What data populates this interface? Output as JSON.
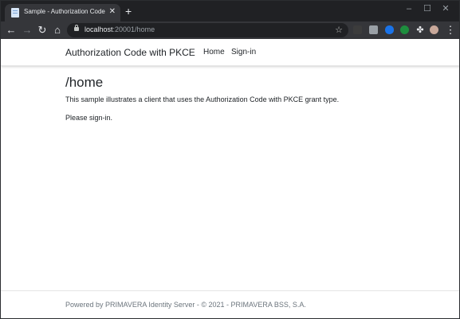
{
  "browser": {
    "tab": {
      "title": "Sample - Authorization Code wit",
      "close": "✕"
    },
    "new_tab": "+",
    "window_controls": {
      "minimize": "–",
      "maximize": "☐",
      "close": "✕"
    },
    "nav": {
      "back": "←",
      "forward": "→",
      "reload": "↻",
      "home": "⌂"
    },
    "address": {
      "host": "localhost",
      "path": ":20001/home"
    },
    "star": "☆",
    "extension_colors": [
      "#3c3c3c",
      "#8ab4f8",
      "#1a73e8",
      "#1e8e3e"
    ],
    "menu": "⋮"
  },
  "site": {
    "brand": "Authorization Code with PKCE",
    "nav": {
      "home": "Home",
      "signin": "Sign-in"
    }
  },
  "main": {
    "heading": "/home",
    "intro": "This sample illustrates a client that uses the Authorization Code with PKCE grant type.",
    "prompt": "Please sign-in."
  },
  "footer": {
    "text": "Powered by PRIMAVERA Identity Server - © 2021 - PRIMAVERA BSS, S.A."
  }
}
